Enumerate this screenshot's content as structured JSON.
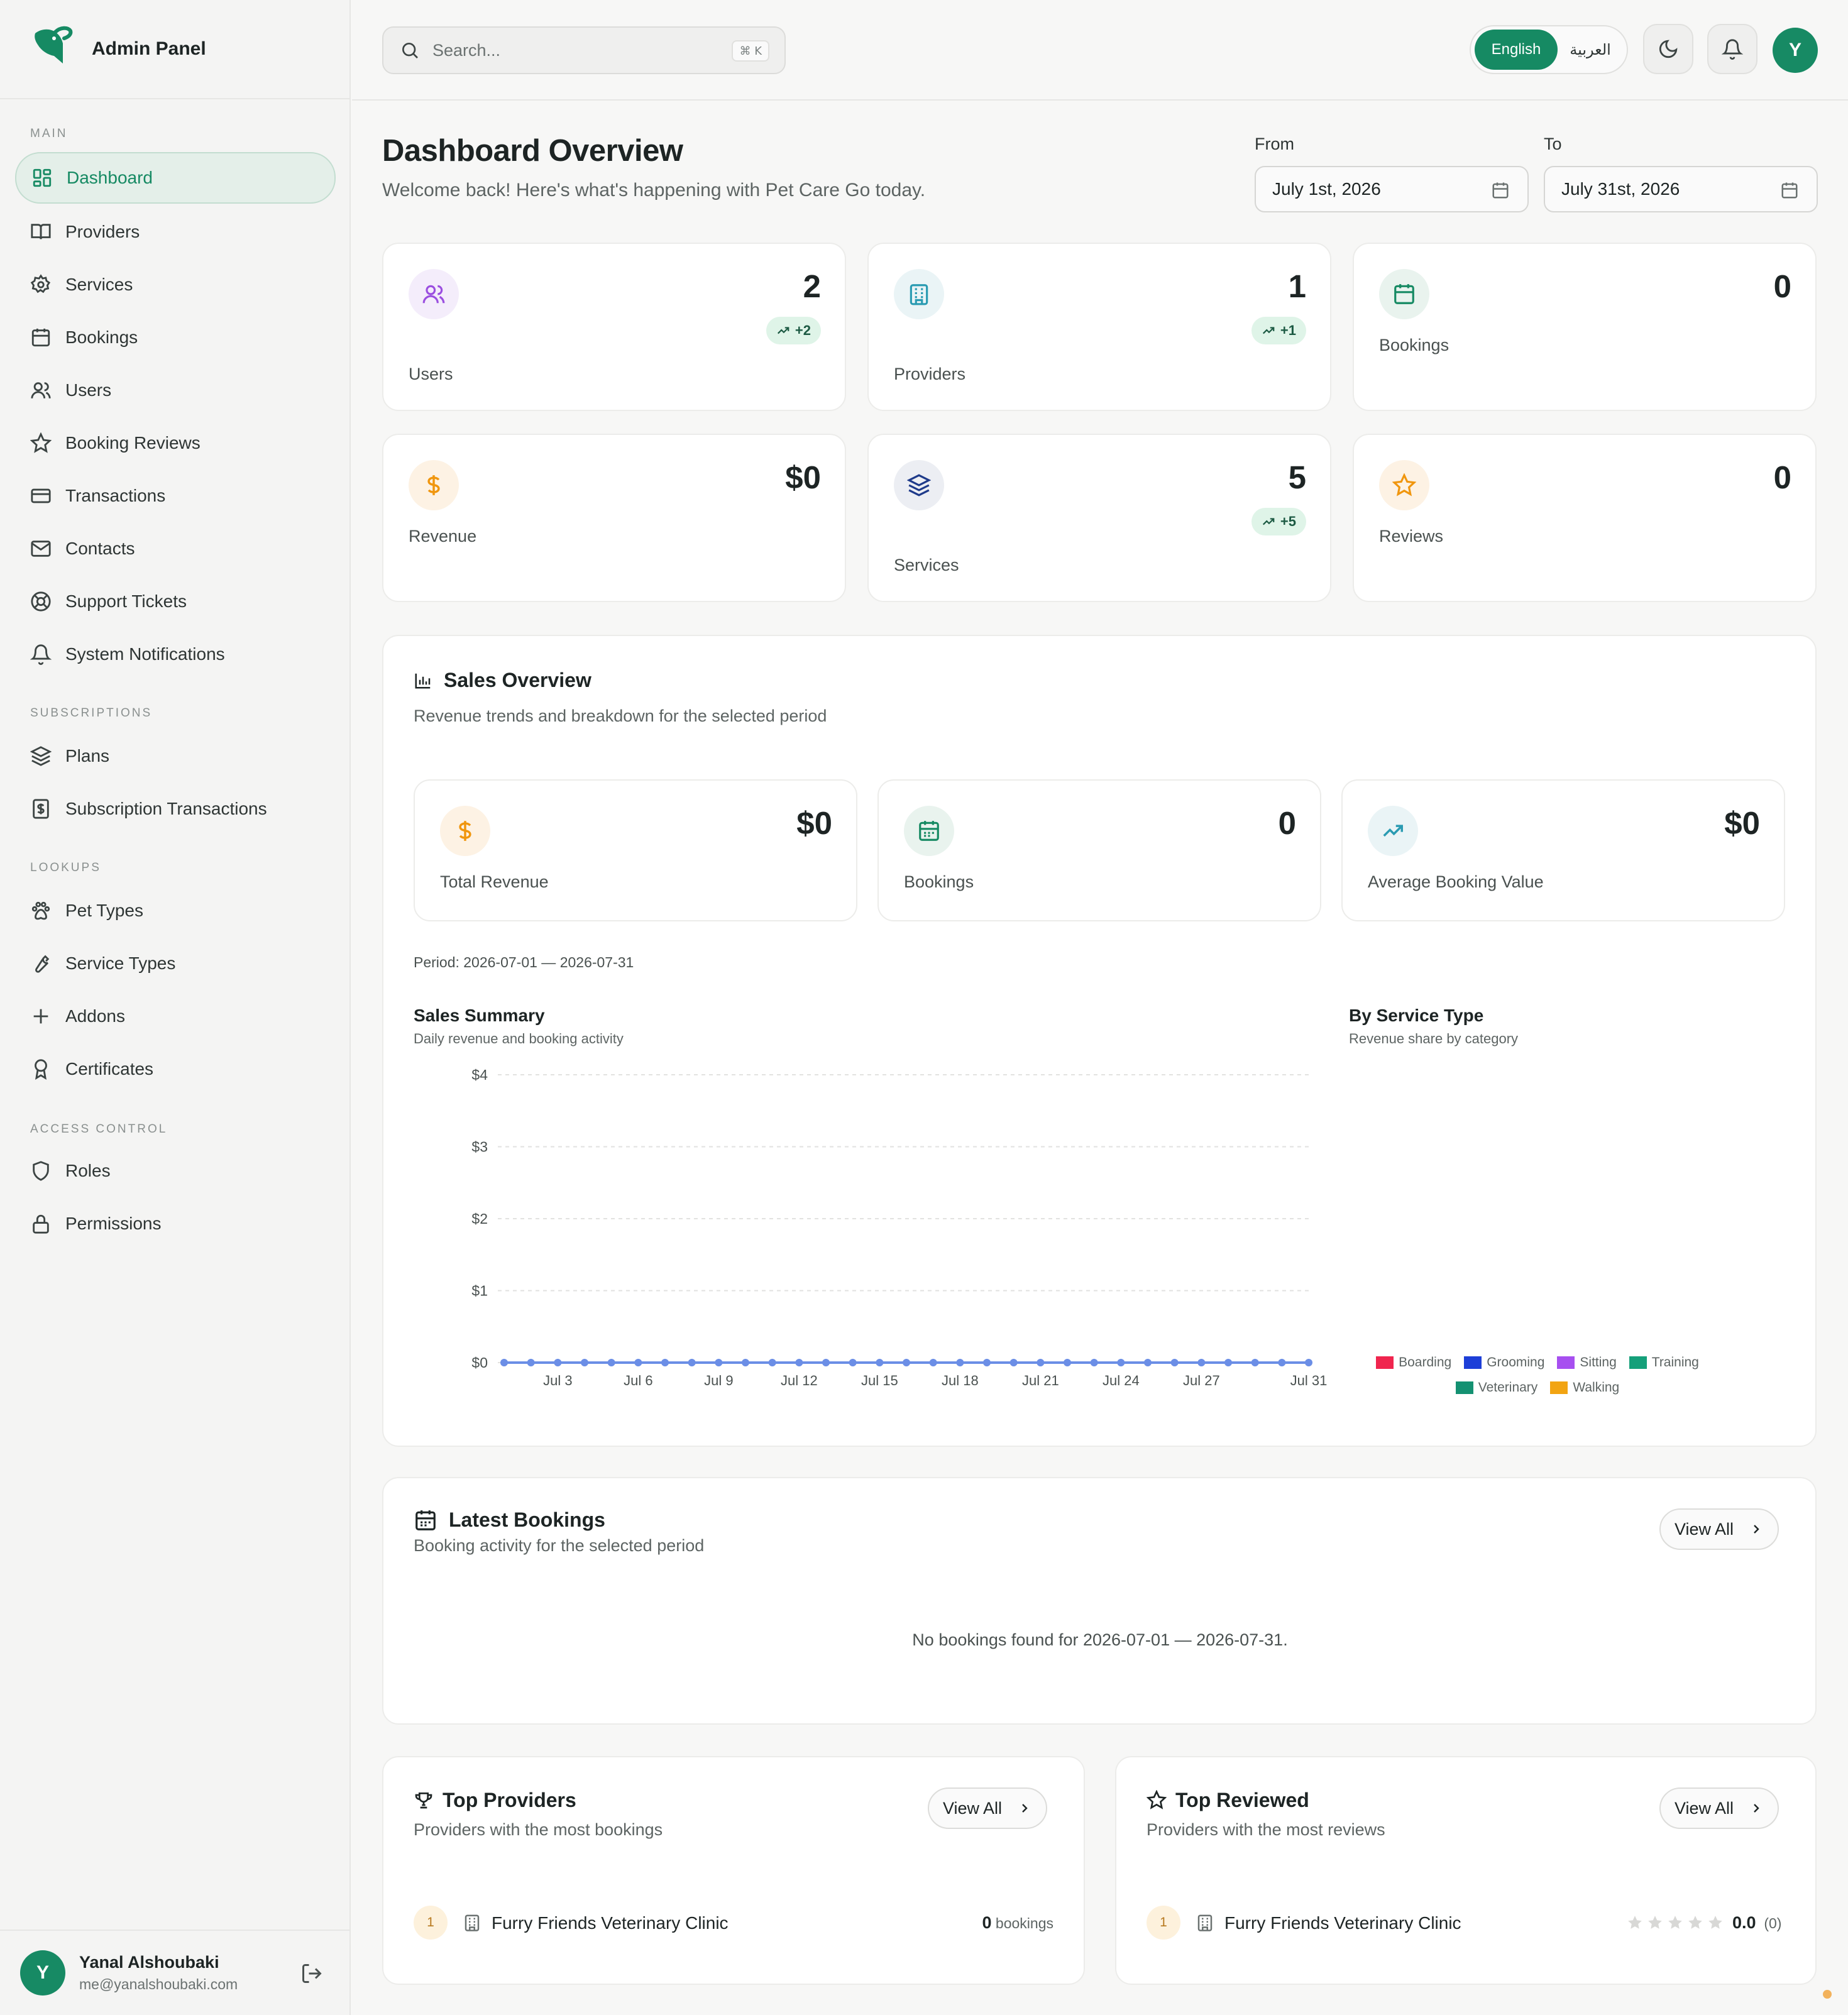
{
  "app": {
    "name": "Admin Panel"
  },
  "sidebar": {
    "sections": {
      "main": "MAIN",
      "subscriptions": "SUBSCRIPTIONS",
      "lookups": "LOOKUPS",
      "access_control": "ACCESS CONTROL"
    },
    "items": [
      {
        "label": "Dashboard",
        "icon": "dashboard-icon"
      },
      {
        "label": "Providers",
        "icon": "book-open-icon"
      },
      {
        "label": "Services",
        "icon": "gear-icon"
      },
      {
        "label": "Bookings",
        "icon": "calendar-icon"
      },
      {
        "label": "Users",
        "icon": "users-icon"
      },
      {
        "label": "Booking Reviews",
        "icon": "star-icon"
      },
      {
        "label": "Transactions",
        "icon": "credit-card-icon"
      },
      {
        "label": "Contacts",
        "icon": "mail-icon"
      },
      {
        "label": "Support Tickets",
        "icon": "lifebuoy-icon"
      },
      {
        "label": "System Notifications",
        "icon": "bell-icon"
      },
      {
        "label": "Plans",
        "icon": "layers-icon"
      },
      {
        "label": "Subscription Transactions",
        "icon": "receipt-icon"
      },
      {
        "label": "Pet Types",
        "icon": "paw-icon"
      },
      {
        "label": "Service Types",
        "icon": "wrench-icon"
      },
      {
        "label": "Addons",
        "icon": "plus-icon"
      },
      {
        "label": "Certificates",
        "icon": "award-icon"
      },
      {
        "label": "Roles",
        "icon": "shield-icon"
      },
      {
        "label": "Permissions",
        "icon": "lock-icon"
      }
    ],
    "user": {
      "initial": "Y",
      "name": "Yanal Alshoubaki",
      "email": "me@yanalshoubaki.com"
    }
  },
  "topbar": {
    "search_placeholder": "Search...",
    "shortcut": "⌘ K",
    "lang_en": "English",
    "lang_ar": "العربية",
    "avatar_initial": "Y"
  },
  "header": {
    "title": "Dashboard Overview",
    "subtitle": "Welcome back! Here's what's happening with Pet Care Go today.",
    "from_label": "From",
    "from_value": "July 1st, 2026",
    "to_label": "To",
    "to_value": "July 31st, 2026"
  },
  "stats": [
    {
      "label": "Users",
      "value": "2",
      "delta": "+2"
    },
    {
      "label": "Providers",
      "value": "1",
      "delta": "+1"
    },
    {
      "label": "Bookings",
      "value": "0",
      "delta": ""
    },
    {
      "label": "Revenue",
      "value": "$0",
      "delta": ""
    },
    {
      "label": "Services",
      "value": "5",
      "delta": "+5"
    },
    {
      "label": "Reviews",
      "value": "0",
      "delta": ""
    }
  ],
  "sales": {
    "title": "Sales Overview",
    "subtitle": "Revenue trends and breakdown for the selected period",
    "cards": [
      {
        "label": "Total Revenue",
        "value": "$0"
      },
      {
        "label": "Bookings",
        "value": "0"
      },
      {
        "label": "Average Booking Value",
        "value": "$0"
      }
    ],
    "period": "Period: 2026-07-01 — 2026-07-31",
    "summary_title": "Sales Summary",
    "summary_sub": "Daily revenue and booking activity",
    "by_type_title": "By Service Type",
    "by_type_sub": "Revenue share by category"
  },
  "chart_data": [
    {
      "type": "line",
      "title": "Sales Summary",
      "subtitle": "Daily revenue and booking activity",
      "x": [
        "Jul 1",
        "Jul 2",
        "Jul 3",
        "Jul 4",
        "Jul 5",
        "Jul 6",
        "Jul 7",
        "Jul 8",
        "Jul 9",
        "Jul 10",
        "Jul 11",
        "Jul 12",
        "Jul 13",
        "Jul 14",
        "Jul 15",
        "Jul 16",
        "Jul 17",
        "Jul 18",
        "Jul 19",
        "Jul 20",
        "Jul 21",
        "Jul 22",
        "Jul 23",
        "Jul 24",
        "Jul 25",
        "Jul 26",
        "Jul 27",
        "Jul 28",
        "Jul 29",
        "Jul 30",
        "Jul 31"
      ],
      "x_tick_labels": [
        "Jul 3",
        "Jul 6",
        "Jul 9",
        "Jul 12",
        "Jul 15",
        "Jul 18",
        "Jul 21",
        "Jul 24",
        "Jul 27",
        "Jul 31"
      ],
      "series": [
        {
          "values": [
            0,
            0,
            0,
            0,
            0,
            0,
            0,
            0,
            0,
            0,
            0,
            0,
            0,
            0,
            0,
            0,
            0,
            0,
            0,
            0,
            0,
            0,
            0,
            0,
            0,
            0,
            0,
            0,
            0,
            0,
            0
          ],
          "color": "#6b8ee6"
        }
      ],
      "y_ticks": [
        "$0",
        "$1",
        "$2",
        "$3",
        "$4"
      ],
      "ylim": [
        0,
        4
      ],
      "grid": true
    },
    {
      "type": "pie",
      "title": "By Service Type",
      "subtitle": "Revenue share by category",
      "legend": [
        {
          "name": "Boarding",
          "color": "#f0254e"
        },
        {
          "name": "Grooming",
          "color": "#1d3fd8"
        },
        {
          "name": "Sitting",
          "color": "#a74ff0"
        },
        {
          "name": "Training",
          "color": "#15a07a"
        },
        {
          "name": "Veterinary",
          "color": "#149172"
        },
        {
          "name": "Walking",
          "color": "#f2a412"
        }
      ],
      "values": [
        0,
        0,
        0,
        0,
        0,
        0
      ]
    }
  ],
  "latest": {
    "title": "Latest Bookings",
    "subtitle": "Booking activity for the selected period",
    "view_all": "View All",
    "empty": "No bookings found for 2026-07-01 — 2026-07-31."
  },
  "top_providers": {
    "title": "Top Providers",
    "subtitle": "Providers with the most bookings",
    "view_all": "View All",
    "rows": [
      {
        "rank": "1",
        "name": "Furry Friends Veterinary Clinic",
        "count": "0",
        "unit": "bookings"
      }
    ]
  },
  "top_reviewed": {
    "title": "Top Reviewed",
    "subtitle": "Providers with the most reviews",
    "view_all": "View All",
    "rows": [
      {
        "rank": "1",
        "name": "Furry Friends Veterinary Clinic",
        "rating": "0.0",
        "count": "(0)"
      }
    ]
  },
  "colors": {
    "accent": "#168a63",
    "positive_bg": "#dff4e8",
    "line": "#6b8ee6"
  }
}
